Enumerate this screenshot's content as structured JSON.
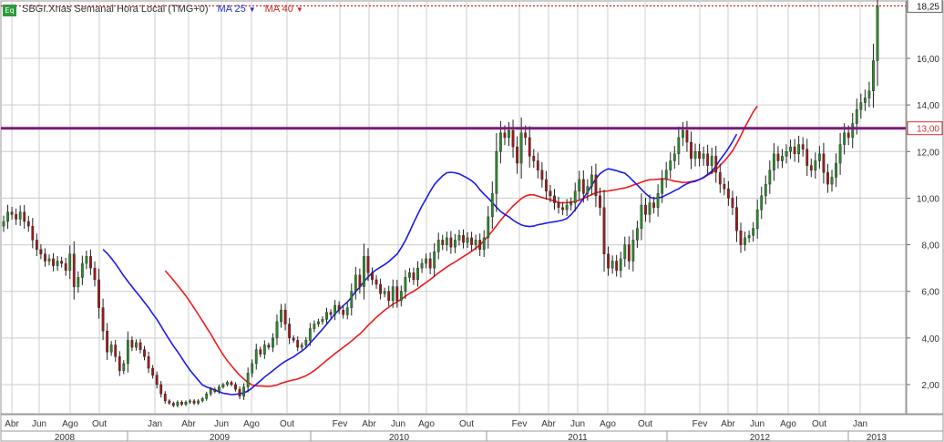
{
  "header": {
    "badge": "Eq",
    "symbol_label": "SBGI.Xnas Semanal Hora Local (TMG+0)",
    "ma1_label": "MA 25",
    "ma2_label": "MA 40"
  },
  "chart_data": {
    "type": "candlestick",
    "frequency": "weekly",
    "ylim": [
      0.5,
      18.6
    ],
    "y_ticks": [
      2,
      4,
      6,
      8,
      10,
      12,
      14,
      16
    ],
    "y_tick_labels": [
      "2,00",
      "4,00",
      "6,00",
      "8,00",
      "10,00",
      "12,00",
      "14,00",
      "16,00"
    ],
    "last_price_label": "18,25",
    "last_price": 18.25,
    "horizontal_line": {
      "value": 13.0,
      "label": "13,00",
      "color": "#7a1a7a"
    },
    "month_labels": [
      "Abr",
      "Jun",
      "Ago",
      "Out",
      "Jan",
      "Abr",
      "Jun",
      "Ago",
      "Out",
      "Fev",
      "Abr",
      "Jun",
      "Ago",
      "Out",
      "Fev",
      "Abr",
      "Jun",
      "Ago",
      "Out",
      "Fev",
      "Abr",
      "Jun",
      "Ago",
      "Out",
      "Jan"
    ],
    "year_labels": [
      "2008",
      "2009",
      "2010",
      "2011",
      "2012",
      "2013"
    ],
    "colors": {
      "up": "#2a8a2a",
      "down": "#a01818",
      "ma1": "#1a1aee",
      "ma2": "#ee1a1a",
      "grid": "#cccccc",
      "last_price_line": "#cc0000"
    },
    "close": [
      9.0,
      9.4,
      9.3,
      9.1,
      9.4,
      9.0,
      8.8,
      8.2,
      7.8,
      7.6,
      7.3,
      7.4,
      7.1,
      7.3,
      7.2,
      6.9,
      7.6,
      6.2,
      6.6,
      7.2,
      7.5,
      7.0,
      6.5,
      5.3,
      4.3,
      3.4,
      3.7,
      3.2,
      2.6,
      2.9,
      3.9,
      3.6,
      3.8,
      3.5,
      3.2,
      2.7,
      2.4,
      2.0,
      1.6,
      1.3,
      1.2,
      1.1,
      1.25,
      1.15,
      1.25,
      1.3,
      1.2,
      1.3,
      1.4,
      1.6,
      1.8,
      1.7,
      1.9,
      2.0,
      2.1,
      2.0,
      1.8,
      1.5,
      1.9,
      2.5,
      2.9,
      3.5,
      3.3,
      3.7,
      3.6,
      4.0,
      4.7,
      5.2,
      4.6,
      4.0,
      3.9,
      3.6,
      3.7,
      3.9,
      4.4,
      4.6,
      4.7,
      4.8,
      5.1,
      5.0,
      5.4,
      5.2,
      5.0,
      5.3,
      6.0,
      6.7,
      6.2,
      7.5,
      6.8,
      6.5,
      6.3,
      5.9,
      6.0,
      5.6,
      6.2,
      5.6,
      6.0,
      6.6,
      6.8,
      6.5,
      7.0,
      7.2,
      7.4,
      7.0,
      7.7,
      8.2,
      8.0,
      8.3,
      7.9,
      8.2,
      8.4,
      8.1,
      8.3,
      8.0,
      8.2,
      7.8,
      8.3,
      9.2,
      10.2,
      12.0,
      12.8,
      12.6,
      12.9,
      12.2,
      11.5,
      12.8,
      12.6,
      11.8,
      11.6,
      11.2,
      10.8,
      10.3,
      10.1,
      9.8,
      9.6,
      9.5,
      9.7,
      9.8,
      10.3,
      10.8,
      10.2,
      10.5,
      11.0,
      10.1,
      9.6,
      7.6,
      7.0,
      7.3,
      6.9,
      7.4,
      8.0,
      7.3,
      8.2,
      8.7,
      9.7,
      9.3,
      9.8,
      9.6,
      10.2,
      10.8,
      11.2,
      11.6,
      11.9,
      12.6,
      12.9,
      12.4,
      11.7,
      12.0,
      11.7,
      11.9,
      11.4,
      11.8,
      11.1,
      10.6,
      10.4,
      10.0,
      9.6,
      8.6,
      8.0,
      8.3,
      8.4,
      8.7,
      9.5,
      10.1,
      10.6,
      11.2,
      11.9,
      11.6,
      11.8,
      12.0,
      12.2,
      11.9,
      12.3,
      12.1,
      11.4,
      11.2,
      11.6,
      11.9,
      11.1,
      10.6,
      10.9,
      11.5,
      12.3,
      12.8,
      12.6,
      13.2,
      13.8,
      14.1,
      14.3,
      14.6,
      15.9,
      18.25
    ],
    "ma1": [
      null,
      null,
      null,
      null,
      null,
      null,
      null,
      null,
      null,
      null,
      null,
      null,
      null,
      null,
      null,
      null,
      null,
      null,
      null,
      null,
      null,
      null,
      null,
      null,
      7.8,
      7.63,
      7.42,
      7.19,
      6.93,
      6.66,
      6.43,
      6.2,
      5.98,
      5.76,
      5.53,
      5.3,
      5.04,
      4.8,
      4.51,
      4.21,
      3.93,
      3.66,
      3.41,
      3.15,
      2.87,
      2.62,
      2.4,
      2.19,
      1.98,
      1.9,
      1.83,
      1.77,
      1.7,
      1.63,
      1.6,
      1.57,
      1.58,
      1.61,
      1.64,
      1.73,
      1.85,
      2.01,
      2.16,
      2.32,
      2.46,
      2.6,
      2.74,
      2.88,
      3.0,
      3.1,
      3.19,
      3.32,
      3.44,
      3.58,
      3.78,
      3.97,
      4.18,
      4.38,
      4.59,
      4.81,
      5.03,
      5.21,
      5.39,
      5.54,
      5.75,
      5.99,
      6.18,
      6.42,
      6.62,
      6.8,
      6.93,
      7.04,
      7.15,
      7.28,
      7.44,
      7.6,
      7.87,
      8.18,
      8.55,
      8.95,
      9.31,
      9.66,
      9.97,
      10.29,
      10.58,
      10.78,
      10.96,
      11.09,
      11.11,
      11.09,
      11.04,
      10.95,
      10.86,
      10.75,
      10.59,
      10.36,
      10.17,
      10.0,
      9.81,
      9.61,
      9.43,
      9.3,
      9.2,
      9.06,
      8.95,
      8.85,
      8.8,
      8.78,
      8.8,
      8.86,
      8.89,
      8.93,
      8.96,
      8.99,
      9.02,
      9.06,
      9.13,
      9.29,
      9.5,
      9.74,
      10.0,
      10.26,
      10.55,
      10.83,
      11.05,
      11.18,
      11.26,
      11.22,
      11.18,
      11.12,
      11.07,
      10.92,
      10.74,
      10.57,
      10.38,
      10.2,
      10.05,
      9.99,
      10.01,
      10.05,
      10.14,
      10.22,
      10.32,
      10.4,
      10.52,
      10.62,
      10.69,
      10.72,
      10.8,
      10.89,
      11.02,
      11.15,
      11.37,
      11.65,
      11.88,
      12.14,
      12.42,
      12.75
    ],
    "ma2": [
      null,
      null,
      null,
      null,
      null,
      null,
      null,
      null,
      null,
      null,
      null,
      null,
      null,
      null,
      null,
      null,
      null,
      null,
      null,
      null,
      null,
      null,
      null,
      null,
      null,
      null,
      null,
      null,
      null,
      null,
      null,
      null,
      null,
      null,
      null,
      null,
      null,
      null,
      null,
      6.89,
      6.69,
      6.48,
      6.26,
      6.04,
      5.81,
      5.55,
      5.28,
      5.01,
      4.73,
      4.45,
      4.17,
      3.86,
      3.57,
      3.28,
      3.03,
      2.81,
      2.6,
      2.4,
      2.24,
      2.09,
      1.98,
      1.95,
      1.94,
      1.93,
      1.92,
      1.94,
      1.98,
      2.06,
      2.11,
      2.16,
      2.2,
      2.24,
      2.31,
      2.38,
      2.48,
      2.6,
      2.74,
      2.89,
      3.04,
      3.18,
      3.33,
      3.46,
      3.6,
      3.73,
      3.87,
      4.03,
      4.17,
      4.35,
      4.54,
      4.71,
      4.89,
      5.04,
      5.19,
      5.32,
      5.45,
      5.55,
      5.66,
      5.79,
      5.91,
      6.01,
      6.12,
      6.25,
      6.38,
      6.51,
      6.65,
      6.79,
      6.92,
      7.04,
      7.16,
      7.26,
      7.38,
      7.49,
      7.6,
      7.72,
      7.85,
      8.0,
      8.17,
      8.38,
      8.59,
      8.82,
      9.05,
      9.26,
      9.47,
      9.66,
      9.82,
      9.98,
      10.09,
      10.14,
      10.14,
      10.09,
      10.03,
      9.98,
      9.93,
      9.88,
      9.81,
      9.8,
      9.8,
      9.83,
      9.86,
      9.91,
      9.98,
      10.07,
      10.15,
      10.23,
      10.27,
      10.3,
      10.31,
      10.34,
      10.37,
      10.41,
      10.44,
      10.49,
      10.56,
      10.62,
      10.68,
      10.75,
      10.79,
      10.8,
      10.81,
      10.83,
      10.82,
      10.78,
      10.73,
      10.7,
      10.67,
      10.68,
      10.71,
      10.75,
      10.8,
      10.87,
      10.99,
      11.09,
      11.22,
      11.41,
      11.58,
      11.8,
      12.03,
      12.34,
      12.68,
      13.05,
      13.38,
      13.7,
      13.95
    ]
  }
}
